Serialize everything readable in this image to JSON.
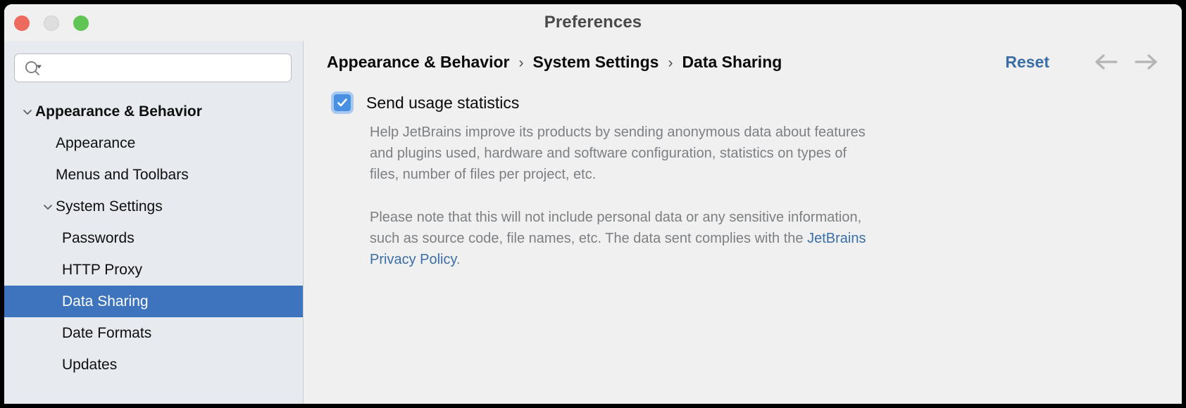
{
  "window": {
    "title": "Preferences",
    "traffic_lights": [
      {
        "name": "close",
        "color": "#ed6a5e"
      },
      {
        "name": "minimize",
        "color": "#dedede"
      },
      {
        "name": "maximize",
        "color": "#61c454"
      }
    ]
  },
  "sidebar": {
    "search": {
      "value": "",
      "placeholder": "",
      "icon": "search-icon",
      "dropdown_icon": "triangle-down-icon"
    },
    "items": [
      {
        "label": "Appearance & Behavior",
        "level": 0,
        "expanded": true,
        "has_twisty": true,
        "bold": true,
        "selected": false
      },
      {
        "label": "Appearance",
        "level": 1,
        "expanded": false,
        "has_twisty": false,
        "bold": false,
        "selected": false
      },
      {
        "label": "Menus and Toolbars",
        "level": 1,
        "expanded": false,
        "has_twisty": false,
        "bold": false,
        "selected": false
      },
      {
        "label": "System Settings",
        "level": 1,
        "expanded": true,
        "has_twisty": true,
        "bold": false,
        "selected": false
      },
      {
        "label": "Passwords",
        "level": 2,
        "expanded": false,
        "has_twisty": false,
        "bold": false,
        "selected": false
      },
      {
        "label": "HTTP Proxy",
        "level": 2,
        "expanded": false,
        "has_twisty": false,
        "bold": false,
        "selected": false
      },
      {
        "label": "Data Sharing",
        "level": 2,
        "expanded": false,
        "has_twisty": false,
        "bold": false,
        "selected": true
      },
      {
        "label": "Date Formats",
        "level": 2,
        "expanded": false,
        "has_twisty": false,
        "bold": false,
        "selected": false
      },
      {
        "label": "Updates",
        "level": 2,
        "expanded": false,
        "has_twisty": false,
        "bold": false,
        "selected": false
      }
    ],
    "selection_color": "#3d74bd",
    "background_color": "#e7eaee"
  },
  "content": {
    "breadcrumb": {
      "separator": "›",
      "parts": [
        "Appearance & Behavior",
        "System Settings",
        "Data Sharing"
      ]
    },
    "reset_label": "Reset",
    "nav": {
      "back_icon": "arrow-left-icon",
      "forward_icon": "arrow-right-icon"
    },
    "accent_color": "#3a6ea5",
    "setting": {
      "checkbox_label": "Send usage statistics",
      "checkbox_checked": true,
      "checkbox_color": "#4a90e2",
      "paragraph_1": "Help JetBrains improve its products by sending anonymous data about features and plugins used, hardware and software configuration, statistics on types of files, number of files per project, etc.",
      "paragraph_2_prefix": "Please note that this will not include personal data or any sensitive information, such as source code, file names, etc. The data sent complies with the ",
      "paragraph_2_link": "JetBrains Privacy Policy",
      "paragraph_2_suffix": "."
    }
  }
}
